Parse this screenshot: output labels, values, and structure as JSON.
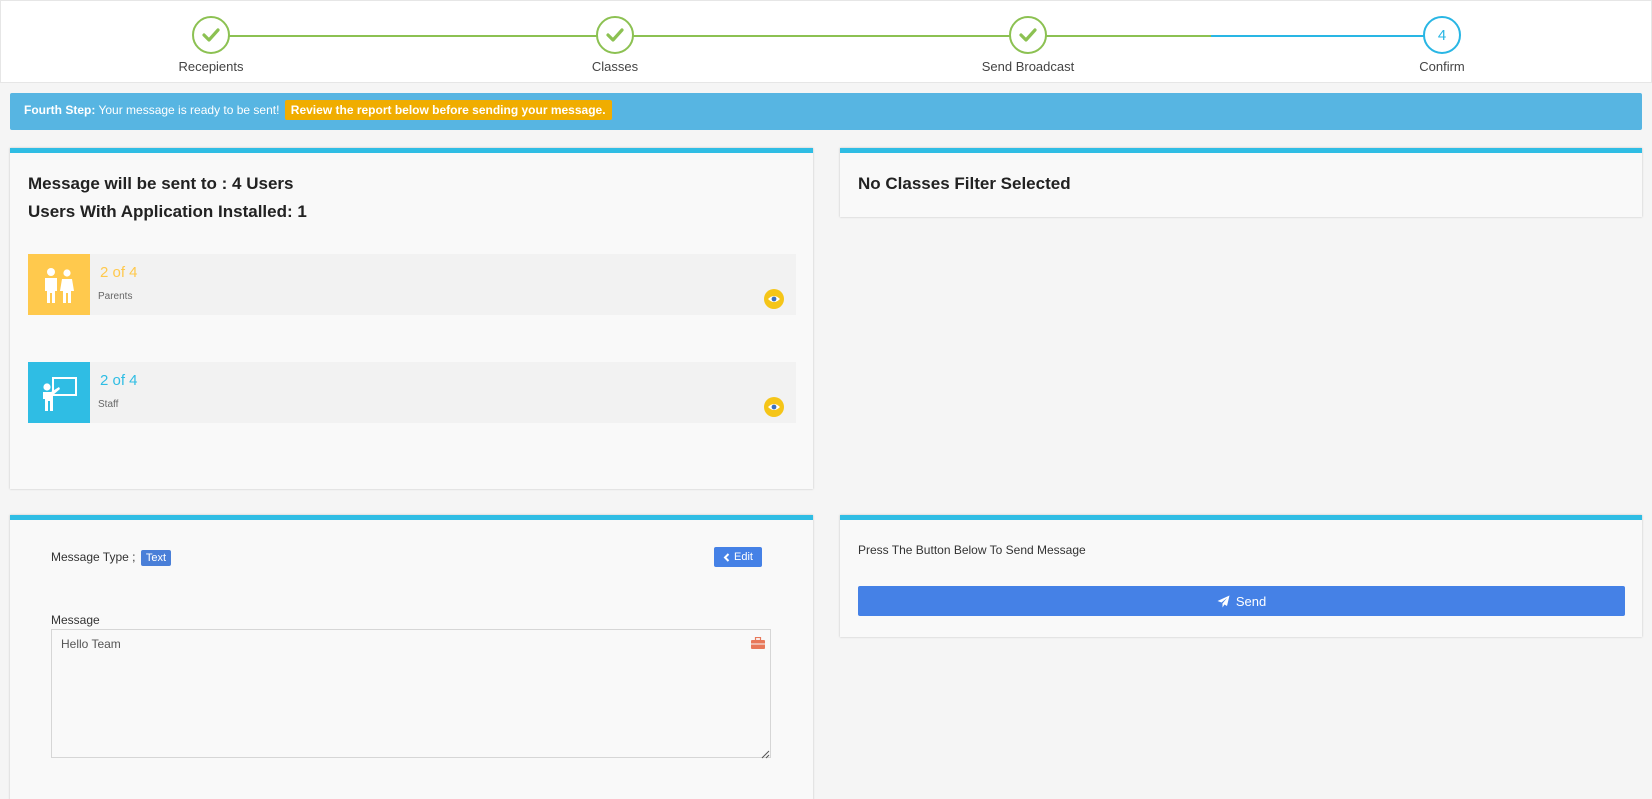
{
  "stepper": {
    "steps": [
      {
        "label": "Recepients",
        "state": "done"
      },
      {
        "label": "Classes",
        "state": "done"
      },
      {
        "label": "Send Broadcast",
        "state": "done"
      },
      {
        "label": "Confirm",
        "state": "active",
        "number": "4"
      }
    ],
    "done_color": "#8cc152",
    "active_color": "#29b6e4"
  },
  "alert": {
    "step_label": "Fourth Step:",
    "text": "Your message is ready to be sent!",
    "highlight": "Review the report below before sending your message."
  },
  "summary": {
    "sent_to": "Message will be sent to : 4 Users",
    "installed": "Users With Application Installed: 1",
    "groups": [
      {
        "count": "2 of 4",
        "label": "Parents",
        "icon": "parents-icon",
        "color": "#ffc94d"
      },
      {
        "count": "2 of 4",
        "label": "Staff",
        "icon": "teacher-icon",
        "color": "#2fbde4"
      }
    ]
  },
  "classes": {
    "title": "No Classes Filter Selected"
  },
  "message": {
    "type_label": "Message Type ;",
    "type_value": "Text",
    "edit_label": "Edit",
    "field_label": "Message",
    "body": "Hello Team"
  },
  "send": {
    "hint": "Press The Button Below To Send Message",
    "button_label": "Send"
  }
}
